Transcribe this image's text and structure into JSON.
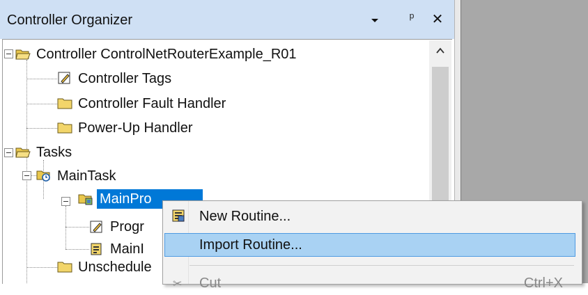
{
  "window": {
    "title": "Controller Organizer",
    "colors": {
      "titlebar": "#cfe0f4",
      "selection": "#0078d7",
      "menu_highlight": "#a9d2f3",
      "folder": "#f2d56a"
    }
  },
  "titlebar": {
    "pin_glyph": "ᵖ",
    "close_glyph": "✕"
  },
  "tree": {
    "items": [
      {
        "label": "Controller ControlNetRouterExample_R01",
        "icon": "folder-open-icon"
      },
      {
        "label": "Controller Tags",
        "icon": "tags-icon"
      },
      {
        "label": "Controller Fault Handler",
        "icon": "folder-icon"
      },
      {
        "label": "Power-Up Handler",
        "icon": "folder-icon"
      },
      {
        "label": "Tasks",
        "icon": "folder-open-icon"
      },
      {
        "label": "MainTask",
        "icon": "task-icon"
      },
      {
        "label": "MainPro",
        "icon": "program-icon",
        "selected": true
      },
      {
        "label": "Progr",
        "icon": "tags-icon"
      },
      {
        "label": "MainI",
        "icon": "routine-icon"
      },
      {
        "label": "Unschedule",
        "icon": "folder-icon"
      }
    ]
  },
  "context_menu": {
    "items": [
      {
        "label": "New Routine...",
        "icon": "new-routine-icon",
        "shortcut": ""
      },
      {
        "label": "Import Routine...",
        "icon": "",
        "shortcut": "",
        "highlighted": true
      },
      {
        "label": "Cut",
        "icon": "cut-icon",
        "shortcut": "Ctrl+X"
      }
    ]
  }
}
